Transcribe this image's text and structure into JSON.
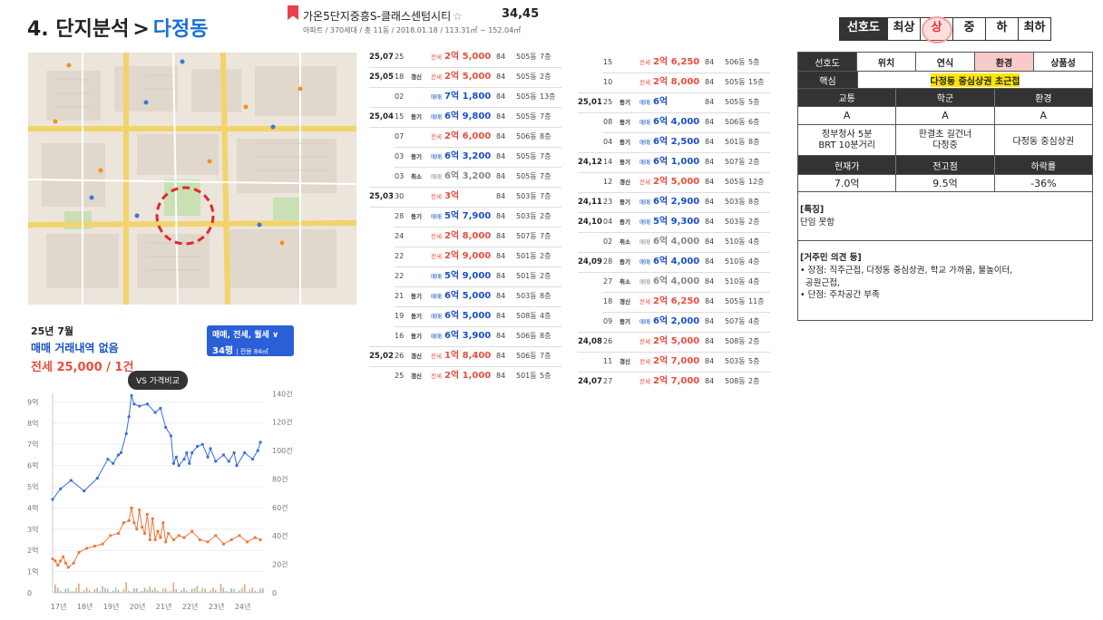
{
  "header": {
    "num": "4.",
    "title": "단지분석",
    "sep": ">",
    "region": "다정동",
    "complex_name": "가온5단지중흥S-클래스센텀시티",
    "complex_number": "34,45",
    "complex_info": "아파트 / 370세대 / 총 11동 / 2018.01.18 / 113.31㎡ ~ 152.04㎡"
  },
  "preference": {
    "label": "선호도",
    "options": [
      "최상",
      "상",
      "중",
      "하",
      "최하"
    ],
    "selected": "상"
  },
  "summary": {
    "month": "25년 7월",
    "no_sale": "매매 거래내역 없음",
    "jeonse": "전세 25,000 / 1건"
  },
  "filter": {
    "types": "매매, 전세, 월세",
    "area": "34평",
    "area_sub": "전용 84㎡"
  },
  "vs_button": "VS 가격비교",
  "chart_data": {
    "type": "line",
    "x_ticks": [
      "17년",
      "18년",
      "19년",
      "20년",
      "21년",
      "22년",
      "23년",
      "24년"
    ],
    "y_left_ticks": [
      "0",
      "1억",
      "2억",
      "3억",
      "4억",
      "5억",
      "6억",
      "7억",
      "8억",
      "9억"
    ],
    "y_right_ticks": [
      "0",
      "20건",
      "40건",
      "60건",
      "80건",
      "100건",
      "120건",
      "140건"
    ],
    "series": [
      {
        "color": "#3a6fd8",
        "x": [
          17.0,
          17.3,
          17.7,
          18.2,
          18.7,
          19.1,
          19.3,
          19.5,
          19.6,
          19.8,
          19.9,
          20.0,
          20.1,
          20.3,
          20.6,
          20.9,
          21.1,
          21.3,
          21.5,
          21.6,
          21.7,
          21.8,
          22.0,
          22.1,
          22.2,
          22.3,
          22.5,
          22.7,
          22.9,
          23.0,
          23.2,
          23.5,
          23.7,
          23.9,
          24.0,
          24.3,
          24.6,
          24.8,
          24.9
        ],
        "y": [
          4.4,
          4.9,
          5.3,
          4.8,
          5.4,
          6.3,
          6.1,
          6.5,
          6.6,
          7.5,
          8.3,
          9.3,
          8.9,
          8.8,
          8.9,
          8.5,
          8.7,
          7.8,
          7.4,
          6.1,
          6.4,
          6.0,
          6.3,
          6.6,
          6.1,
          6.6,
          6.9,
          7.0,
          6.4,
          6.8,
          6.2,
          6.5,
          6.2,
          6.6,
          6.0,
          6.6,
          6.3,
          6.7,
          7.1
        ]
      },
      {
        "color": "#f0763f",
        "x": [
          17.0,
          17.1,
          17.2,
          17.3,
          17.4,
          17.5,
          17.6,
          17.8,
          18.0,
          18.3,
          18.6,
          18.9,
          19.2,
          19.5,
          19.7,
          19.9,
          20.0,
          20.1,
          20.2,
          20.3,
          20.4,
          20.5,
          20.6,
          20.7,
          20.8,
          20.9,
          21.0,
          21.1,
          21.2,
          21.3,
          21.4,
          21.6,
          21.8,
          22.0,
          22.3,
          22.6,
          22.9,
          23.2,
          23.5,
          23.8,
          24.1,
          24.4,
          24.7,
          24.9
        ],
        "y": [
          1.6,
          1.5,
          1.3,
          1.5,
          1.7,
          1.4,
          1.2,
          1.4,
          1.9,
          2.1,
          2.2,
          2.3,
          2.7,
          2.8,
          3.3,
          3.4,
          4.0,
          3.3,
          3.0,
          3.9,
          3.1,
          2.8,
          3.7,
          2.5,
          3.5,
          2.5,
          2.9,
          2.6,
          3.3,
          2.4,
          2.8,
          2.5,
          2.7,
          2.6,
          2.9,
          2.5,
          2.4,
          2.7,
          2.3,
          2.5,
          2.7,
          2.4,
          2.6,
          2.5
        ]
      }
    ]
  },
  "list_a": [
    {
      "ym": "25,07",
      "d": "25",
      "tag": "",
      "kind": "jeon",
      "pre": "전세",
      "price": "2억 5,000",
      "size": "84",
      "dong": "505동",
      "fl": "7층"
    },
    {
      "ym": "25,05",
      "d": "18",
      "tag": "갱신",
      "kind": "jeon",
      "pre": "전세",
      "price": "2억 5,000",
      "size": "84",
      "dong": "505동",
      "fl": "2층"
    },
    {
      "ym": "",
      "d": "02",
      "tag": "",
      "kind": "mae",
      "pre": "매매",
      "price": "7억 1,800",
      "size": "84",
      "dong": "505동",
      "fl": "13층"
    },
    {
      "ym": "25,04",
      "d": "15",
      "tag": "등기",
      "kind": "mae",
      "pre": "매매",
      "price": "6억 9,800",
      "size": "84",
      "dong": "505동",
      "fl": "7층"
    },
    {
      "ym": "",
      "d": "07",
      "tag": "",
      "kind": "jeon",
      "pre": "전세",
      "price": "2억 6,000",
      "size": "84",
      "dong": "506동",
      "fl": "8층"
    },
    {
      "ym": "",
      "d": "03",
      "tag": "등기",
      "kind": "mae",
      "pre": "매매",
      "price": "6억 3,200",
      "size": "84",
      "dong": "505동",
      "fl": "7층"
    },
    {
      "ym": "",
      "d": "03",
      "tag": "취소",
      "kind": "can",
      "pre": "매매",
      "price": "6억 3,200",
      "size": "84",
      "dong": "505동",
      "fl": "7층"
    },
    {
      "ym": "25,03",
      "d": "30",
      "tag": "",
      "kind": "jeon",
      "pre": "전세",
      "price": "3억",
      "size": "84",
      "dong": "503동",
      "fl": "7층"
    },
    {
      "ym": "",
      "d": "28",
      "tag": "등기",
      "kind": "mae",
      "pre": "매매",
      "price": "5억 7,900",
      "size": "84",
      "dong": "503동",
      "fl": "2층"
    },
    {
      "ym": "",
      "d": "24",
      "tag": "",
      "kind": "jeon",
      "pre": "전세",
      "price": "2억 8,000",
      "size": "84",
      "dong": "507동",
      "fl": "7층"
    },
    {
      "ym": "",
      "d": "22",
      "tag": "",
      "kind": "jeon",
      "pre": "전세",
      "price": "2억 9,000",
      "size": "84",
      "dong": "501동",
      "fl": "2층"
    },
    {
      "ym": "",
      "d": "22",
      "tag": "",
      "kind": "mae",
      "pre": "매매",
      "price": "5억 9,000",
      "size": "84",
      "dong": "501동",
      "fl": "2층"
    },
    {
      "ym": "",
      "d": "21",
      "tag": "등기",
      "kind": "mae",
      "pre": "매매",
      "price": "6억 5,000",
      "size": "84",
      "dong": "503동",
      "fl": "8층"
    },
    {
      "ym": "",
      "d": "19",
      "tag": "등기",
      "kind": "mae",
      "pre": "매매",
      "price": "6억 5,000",
      "size": "84",
      "dong": "508동",
      "fl": "4층"
    },
    {
      "ym": "",
      "d": "16",
      "tag": "등기",
      "kind": "mae",
      "pre": "매매",
      "price": "6억 3,900",
      "size": "84",
      "dong": "506동",
      "fl": "8층"
    },
    {
      "ym": "25,02",
      "d": "26",
      "tag": "갱신",
      "kind": "jeon",
      "pre": "전세",
      "price": "1억 8,400",
      "size": "84",
      "dong": "506동",
      "fl": "7층"
    },
    {
      "ym": "",
      "d": "25",
      "tag": "갱신",
      "kind": "jeon",
      "pre": "전세",
      "price": "2억 1,000",
      "size": "84",
      "dong": "501동",
      "fl": "5층"
    }
  ],
  "list_b": [
    {
      "ym": "",
      "d": "15",
      "tag": "",
      "kind": "jeon",
      "pre": "전세",
      "price": "2억 6,250",
      "size": "84",
      "dong": "506동",
      "fl": "5층"
    },
    {
      "ym": "",
      "d": "10",
      "tag": "",
      "kind": "jeon",
      "pre": "전세",
      "price": "2억 8,000",
      "size": "84",
      "dong": "505동",
      "fl": "15층"
    },
    {
      "ym": "25,01",
      "d": "25",
      "tag": "등기",
      "kind": "mae",
      "pre": "매매",
      "price": "6억",
      "size": "84",
      "dong": "505동",
      "fl": "5층"
    },
    {
      "ym": "",
      "d": "08",
      "tag": "등기",
      "kind": "mae",
      "pre": "매매",
      "price": "6억 4,000",
      "size": "84",
      "dong": "506동",
      "fl": "6층"
    },
    {
      "ym": "",
      "d": "04",
      "tag": "등기",
      "kind": "mae",
      "pre": "매매",
      "price": "6억 2,500",
      "size": "84",
      "dong": "501동",
      "fl": "8층"
    },
    {
      "ym": "24,12",
      "d": "14",
      "tag": "등기",
      "kind": "mae",
      "pre": "매매",
      "price": "6억 1,000",
      "size": "84",
      "dong": "507동",
      "fl": "2층"
    },
    {
      "ym": "",
      "d": "12",
      "tag": "갱신",
      "kind": "jeon",
      "pre": "전세",
      "price": "2억 5,000",
      "size": "84",
      "dong": "505동",
      "fl": "12층"
    },
    {
      "ym": "24,11",
      "d": "23",
      "tag": "등기",
      "kind": "mae",
      "pre": "매매",
      "price": "6억 2,900",
      "size": "84",
      "dong": "503동",
      "fl": "8층"
    },
    {
      "ym": "24,10",
      "d": "04",
      "tag": "등기",
      "kind": "mae",
      "pre": "매매",
      "price": "5억 9,300",
      "size": "84",
      "dong": "503동",
      "fl": "2층"
    },
    {
      "ym": "",
      "d": "02",
      "tag": "취소",
      "kind": "can",
      "pre": "매매",
      "price": "6억 4,000",
      "size": "84",
      "dong": "510동",
      "fl": "4층"
    },
    {
      "ym": "24,09",
      "d": "28",
      "tag": "등기",
      "kind": "mae",
      "pre": "매매",
      "price": "6억 4,000",
      "size": "84",
      "dong": "510동",
      "fl": "4층"
    },
    {
      "ym": "",
      "d": "27",
      "tag": "취소",
      "kind": "can",
      "pre": "매매",
      "price": "6억 4,000",
      "size": "84",
      "dong": "510동",
      "fl": "4층"
    },
    {
      "ym": "",
      "d": "18",
      "tag": "갱신",
      "kind": "jeon",
      "pre": "전세",
      "price": "2억 6,250",
      "size": "84",
      "dong": "505동",
      "fl": "11층"
    },
    {
      "ym": "",
      "d": "09",
      "tag": "등기",
      "kind": "mae",
      "pre": "매매",
      "price": "6억 2,000",
      "size": "84",
      "dong": "507동",
      "fl": "4층"
    },
    {
      "ym": "24,08",
      "d": "26",
      "tag": "",
      "kind": "jeon",
      "pre": "전세",
      "price": "2억 5,000",
      "size": "84",
      "dong": "508동",
      "fl": "2층"
    },
    {
      "ym": "",
      "d": "11",
      "tag": "갱신",
      "kind": "jeon",
      "pre": "전세",
      "price": "2억 7,000",
      "size": "84",
      "dong": "503동",
      "fl": "5층"
    },
    {
      "ym": "24,07",
      "d": "27",
      "tag": "",
      "kind": "jeon",
      "pre": "전세",
      "price": "2억 7,000",
      "size": "84",
      "dong": "508동",
      "fl": "2층"
    }
  ],
  "info": {
    "cats": [
      "선호도",
      "위치",
      "연식",
      "환경",
      "상품성"
    ],
    "core_label": "핵심",
    "core_value": "다정동 중심상권 초근접",
    "h1": [
      "교통",
      "학군",
      "환경"
    ],
    "grades": [
      "A",
      "A",
      "A"
    ],
    "details": [
      [
        "정부청사 5분",
        "BRT 10분거리"
      ],
      [
        "한결초 길건너",
        "다정중"
      ],
      [
        "다정동 중심상권"
      ]
    ],
    "h2": [
      "현재가",
      "전고점",
      "하락률"
    ],
    "vals": [
      "7.0억",
      "9.5억",
      "-36%"
    ],
    "feature_title": "[특징]",
    "feature": "단임 못함",
    "opinion_title": "[거주민 의견 등]",
    "pros": "• 장점: 직주근접, 다정동 중심상권, 학교 가까움, 물놀이터,",
    "pros2": "공원근접,",
    "cons": "• 단점: 주차공간 부족"
  },
  "colors": {
    "accent": "#1a6fd8",
    "sale": "#1a4fc8",
    "jeonse": "#e84d3d",
    "highlight": "#ffe600"
  }
}
